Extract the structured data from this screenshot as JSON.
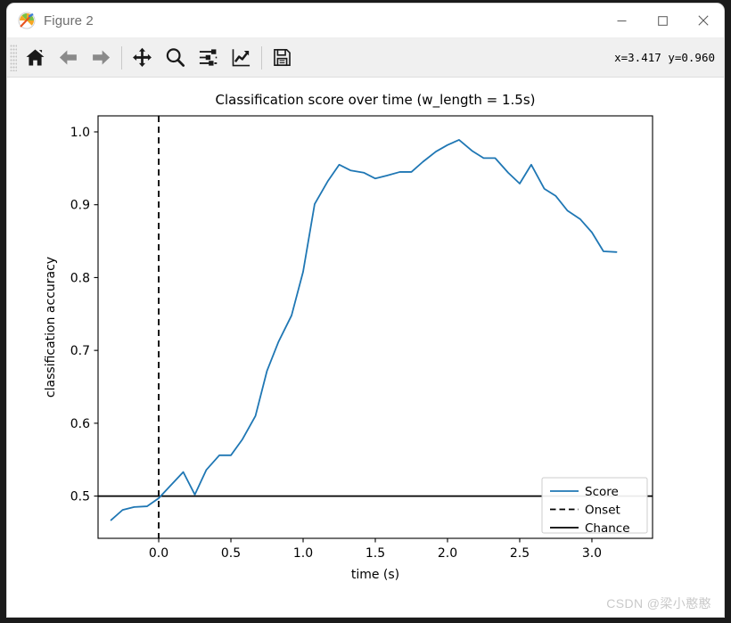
{
  "window": {
    "title": "Figure 2",
    "icon": "matplotlib-logo-icon",
    "minimize_label": "—",
    "maximize_label": "□",
    "close_label": "✕"
  },
  "toolbar": {
    "buttons": [
      {
        "name": "home-icon",
        "tooltip": "Home"
      },
      {
        "name": "back-arrow-icon",
        "tooltip": "Back"
      },
      {
        "name": "forward-arrow-icon",
        "tooltip": "Forward"
      },
      {
        "name": "pan-move-icon",
        "tooltip": "Pan"
      },
      {
        "name": "zoom-magnifier-icon",
        "tooltip": "Zoom to rectangle"
      },
      {
        "name": "configure-subplots-icon",
        "tooltip": "Configure subplots"
      },
      {
        "name": "edit-axis-curve-icon",
        "tooltip": "Edit axis, curve and image parameters"
      },
      {
        "name": "save-floppy-icon",
        "tooltip": "Save the figure"
      }
    ],
    "coordinates": "x=3.417 y=0.960"
  },
  "watermark": "CSDN @梁小憨憨",
  "chart_data": {
    "type": "line",
    "title": "Classification score over time (w_length = 1.5s)",
    "xlabel": "time (s)",
    "ylabel": "classification accuracy",
    "xlim": [
      -0.42,
      3.42
    ],
    "ylim": [
      0.442,
      1.022
    ],
    "xticks": [
      0.0,
      0.5,
      1.0,
      1.5,
      2.0,
      2.5,
      3.0
    ],
    "xticklabels": [
      "0.0",
      "0.5",
      "1.0",
      "1.5",
      "2.0",
      "2.5",
      "3.0"
    ],
    "yticks": [
      0.5,
      0.6,
      0.7,
      0.8,
      0.9,
      1.0
    ],
    "yticklabels": [
      "0.5",
      "0.6",
      "0.7",
      "0.8",
      "0.9",
      "1.0"
    ],
    "grid": false,
    "legend_position": "lower right",
    "series": [
      {
        "name": "Score",
        "color": "#1f77b4",
        "linestyle": "solid",
        "linewidth": 1.8,
        "x": [
          -0.33,
          -0.25,
          -0.17,
          -0.08,
          0.0,
          0.08,
          0.17,
          0.25,
          0.33,
          0.42,
          0.5,
          0.58,
          0.67,
          0.75,
          0.83,
          0.92,
          1.0,
          1.08,
          1.17,
          1.25,
          1.33,
          1.42,
          1.5,
          1.58,
          1.67,
          1.75,
          1.83,
          1.92,
          2.0,
          2.08,
          2.17,
          2.25,
          2.33,
          2.42,
          2.5,
          2.58,
          2.67,
          2.75,
          2.83,
          2.92,
          3.0,
          3.08,
          3.17
        ],
        "y": [
          0.467,
          0.481,
          0.485,
          0.486,
          0.497,
          0.514,
          0.533,
          0.502,
          0.536,
          0.556,
          0.556,
          0.578,
          0.61,
          0.672,
          0.712,
          0.748,
          0.808,
          0.901,
          0.932,
          0.955,
          0.947,
          0.944,
          0.936,
          0.94,
          0.945,
          0.945,
          0.959,
          0.973,
          0.982,
          0.989,
          0.974,
          0.964,
          0.964,
          0.944,
          0.929,
          0.955,
          0.922,
          0.912,
          0.892,
          0.88,
          0.862,
          0.836,
          0.835
        ]
      }
    ],
    "vlines": [
      {
        "name": "Onset",
        "x": 0.0,
        "color": "#000000",
        "linestyle": "dashed",
        "linewidth": 1.8
      }
    ],
    "hlines": [
      {
        "name": "Chance",
        "y": 0.5,
        "color": "#000000",
        "linestyle": "solid",
        "linewidth": 1.8
      }
    ],
    "legend": [
      {
        "label": "Score",
        "color": "#1f77b4",
        "linestyle": "solid"
      },
      {
        "label": "Onset",
        "color": "#000000",
        "linestyle": "dashed"
      },
      {
        "label": "Chance",
        "color": "#000000",
        "linestyle": "solid"
      }
    ]
  }
}
